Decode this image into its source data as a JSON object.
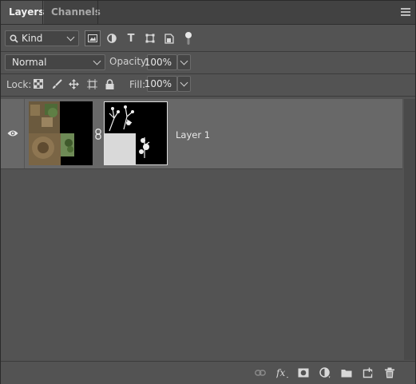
{
  "tabs": [
    {
      "label": "Layers"
    },
    {
      "label": "Channels"
    }
  ],
  "filter": {
    "kind_label": "Kind"
  },
  "blend": {
    "mode": "Normal",
    "opacity_label": "Opacity:",
    "opacity_value": "100%"
  },
  "lock": {
    "label": "Lock:",
    "fill_label": "Fill:",
    "fill_value": "100%"
  },
  "layers": [
    {
      "name": "Layer 1"
    }
  ],
  "colors": {
    "panel": "#535353",
    "tabbar": "#424242",
    "selected_row": "#686868"
  }
}
